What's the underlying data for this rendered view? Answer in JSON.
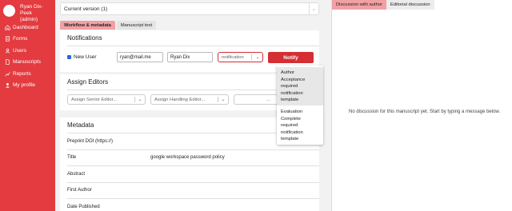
{
  "sidebar": {
    "user_name_line1": "Ryan Dix-Peek",
    "user_name_line2": "(admin)",
    "items": [
      {
        "label": "Dashboard",
        "icon": "home-icon"
      },
      {
        "label": "Forms",
        "icon": "forms-icon"
      },
      {
        "label": "Users",
        "icon": "users-icon"
      },
      {
        "label": "Manuscripts",
        "icon": "manuscripts-icon"
      },
      {
        "label": "Reports",
        "icon": "reports-icon"
      },
      {
        "label": "My profile",
        "icon": "profile-icon"
      }
    ],
    "color": "#e33b40"
  },
  "version_select": {
    "value": "Current version (1)"
  },
  "tabs": {
    "workflow": "Workflow & metadata",
    "manuscript": "Manuscript text"
  },
  "notifications": {
    "title": "Notifications",
    "new_user_label": "New User",
    "email_value": "ryan@mail.me",
    "name_value": "Ryan Dix",
    "template_placeholder": "notification",
    "notify_label": "Notify",
    "options": [
      {
        "lines": [
          "Author",
          "Acceptance",
          "required",
          "notification",
          "template"
        ]
      },
      {
        "lines": [
          "Evaluation",
          "Complete",
          "required",
          "notification",
          "template"
        ]
      }
    ]
  },
  "assign_editors": {
    "title": "Assign Editors",
    "senior_placeholder": "Assign Senior Editor...",
    "handling_placeholder": "Assign Handling Editor...",
    "third_placeholder": "..."
  },
  "metadata": {
    "title": "Metadata",
    "rows": [
      {
        "label": "Preprint DOI (https://)",
        "value": ""
      },
      {
        "label": "Title",
        "value": "google workspace password policy"
      },
      {
        "label": "Abstract",
        "value": ""
      },
      {
        "label": "First Author",
        "value": ""
      },
      {
        "label": "Date Published",
        "value": ""
      }
    ]
  },
  "discussion": {
    "tab_author": "Discussion with author",
    "tab_editorial": "Editorial discussion",
    "empty_text": "No discussion for this manuscript yet. Start by typing a message below."
  },
  "colors": {
    "accent": "#d42f33",
    "tab_active": "#f1a0a3"
  }
}
